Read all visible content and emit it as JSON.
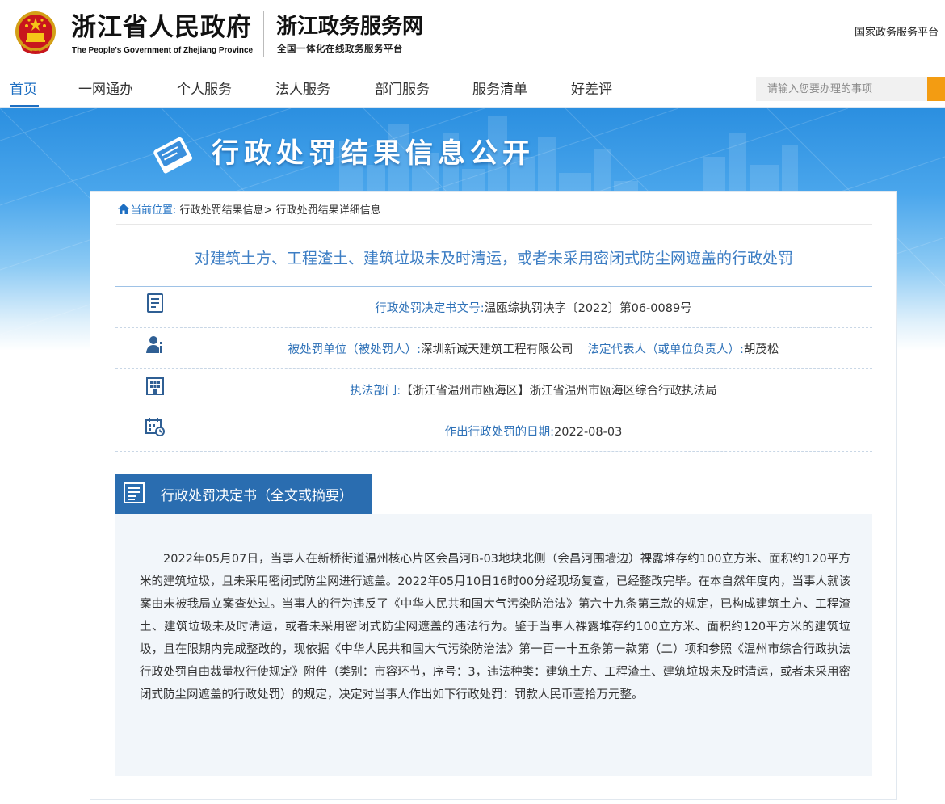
{
  "header": {
    "site_name_cn": "浙江省人民政府",
    "site_name_en": "The People's Government of Zhejiang Province",
    "service_title": "浙江政务服务网",
    "service_subtitle": "全国一体化在线政务服务平台",
    "top_link": "国家政务服务平台"
  },
  "nav": {
    "items": [
      "首页",
      "一网通办",
      "个人服务",
      "法人服务",
      "部门服务",
      "服务清单",
      "好差评"
    ],
    "active_index": 0,
    "search_placeholder": "请输入您要办理的事项"
  },
  "banner": {
    "title": "行政处罚结果信息公开"
  },
  "breadcrumb": {
    "label": "当前位置:",
    "items": [
      "行政处罚结果信息",
      "行政处罚结果详细信息"
    ],
    "separator": ">"
  },
  "document": {
    "title": "对建筑土方、工程渣土、建筑垃圾未及时清运，或者未采用密闭式防尘网遮盖的行政处罚",
    "fields": [
      {
        "icon": "document-icon",
        "label": "行政处罚决定书文号:",
        "value": "温瓯综执罚决字〔2022〕第06-0089号"
      },
      {
        "icon": "person-icon",
        "label": "被处罚单位（被处罚人）:",
        "value": "深圳新诚天建筑工程有限公司",
        "label2": "法定代表人（或单位负责人）:",
        "value2": "胡茂松"
      },
      {
        "icon": "building-icon",
        "label": "执法部门:",
        "value": "【浙江省温州市瓯海区】浙江省温州市瓯海区综合行政执法局"
      },
      {
        "icon": "calendar-icon",
        "label": "作出行政处罚的日期:",
        "value": "2022-08-03"
      }
    ]
  },
  "decision": {
    "section_title": "行政处罚决定书（全文或摘要）",
    "text": "2022年05月07日，当事人在新桥街道温州核心片区会昌河B-03地块北侧（会昌河围墙边）裸露堆存约100立方米、面积约120平方米的建筑垃圾，且未采用密闭式防尘网进行遮盖。2022年05月10日16时00分经现场复查，已经整改完毕。在本自然年度内，当事人就该案由未被我局立案查处过。当事人的行为违反了《中华人民共和国大气污染防治法》第六十九条第三款的规定，已构成建筑土方、工程渣土、建筑垃圾未及时清运，或者未采用密闭式防尘网遮盖的违法行为。鉴于当事人裸露堆存约100立方米、面积约120平方米的建筑垃圾，且在限期内完成整改的，现依据《中华人民共和国大气污染防治法》第一百一十五条第一款第（二）项和参照《温州市综合行政执法行政处罚自由裁量权行使规定》附件（类别：市容环节，序号：3，违法种类：建筑土方、工程渣土、建筑垃圾未及时清运，或者未采用密闭式防尘网遮盖的行政处罚）的规定，决定对当事人作出如下行政处罚：罚款人民币壹拾万元整。"
  },
  "colors": {
    "accent": "#1e6fc2",
    "section_blue": "#2a6db0",
    "title_blue": "#3d7ec4",
    "search_button": "#f39c12"
  }
}
